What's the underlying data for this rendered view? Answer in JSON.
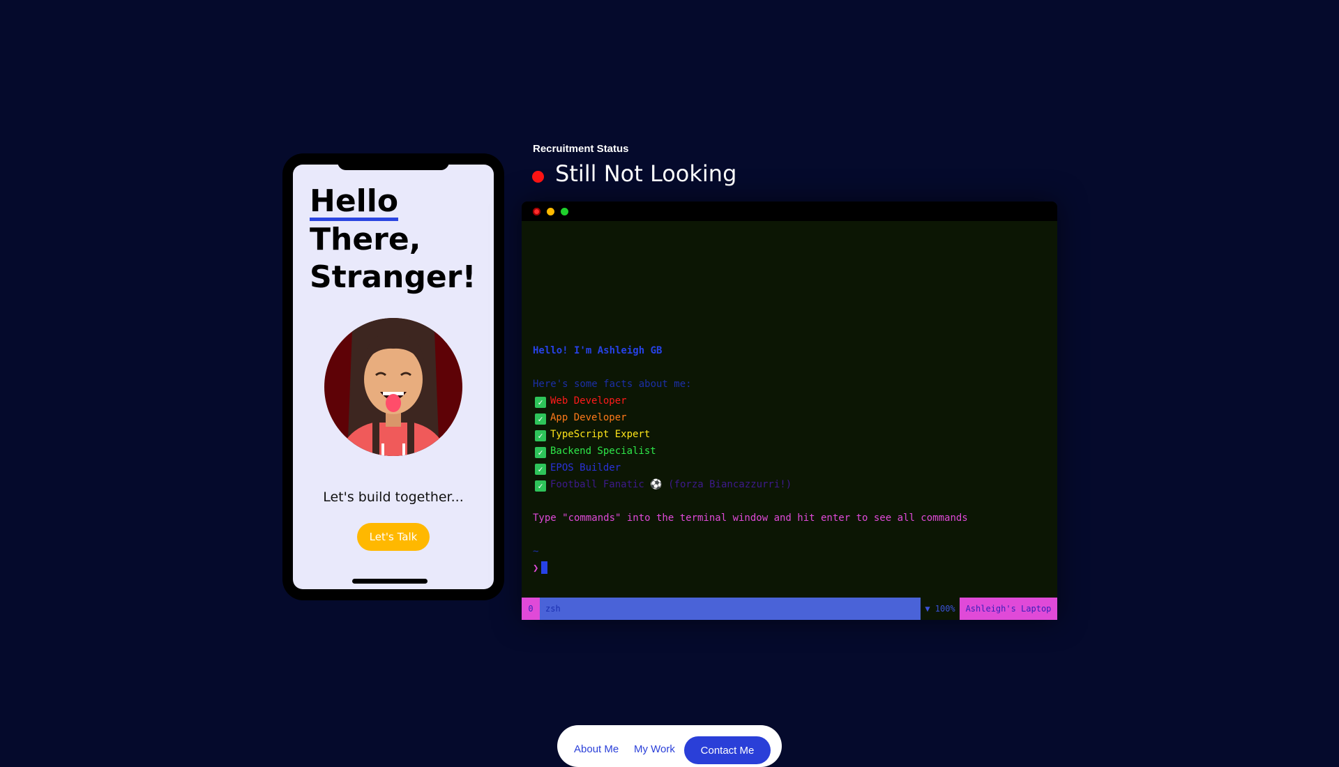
{
  "phone": {
    "greeting_line1": "Hello",
    "greeting_line2": "There,",
    "greeting_line3": "Stranger!",
    "tagline": "Let's build together...",
    "cta_label": "Let's Talk"
  },
  "status": {
    "label": "Recruitment Status",
    "value": "Still Not Looking",
    "dot_color": "#ff1414"
  },
  "terminal": {
    "intro": "Hello! I'm Ashleigh GB",
    "facts_heading": "Here's some facts about me:",
    "facts": [
      {
        "text": "Web Developer",
        "color": "#ff1a1a"
      },
      {
        "text": "App Developer",
        "color": "#ff7a1a"
      },
      {
        "text": "TypeScript Expert",
        "color": "#ffe51a"
      },
      {
        "text": "Backend Specialist",
        "color": "#2ee84a"
      },
      {
        "text": "EPOS Builder",
        "color": "#2a32d8"
      },
      {
        "text": "Football Fanatic ⚽ (forza Biancazzurri!)",
        "color": "#3d1a8c"
      }
    ],
    "hint": "Type \"commands\" into the terminal window and hit enter to see all commands",
    "tilde": "~",
    "prompt_symbol": "❯",
    "statusbar": {
      "pane_index": "0",
      "shell": "zsh",
      "battery": "▼ 100%",
      "host": "Ashleigh's Laptop"
    }
  },
  "nav": {
    "about": "About Me",
    "work": "My Work",
    "contact": "Contact Me"
  }
}
